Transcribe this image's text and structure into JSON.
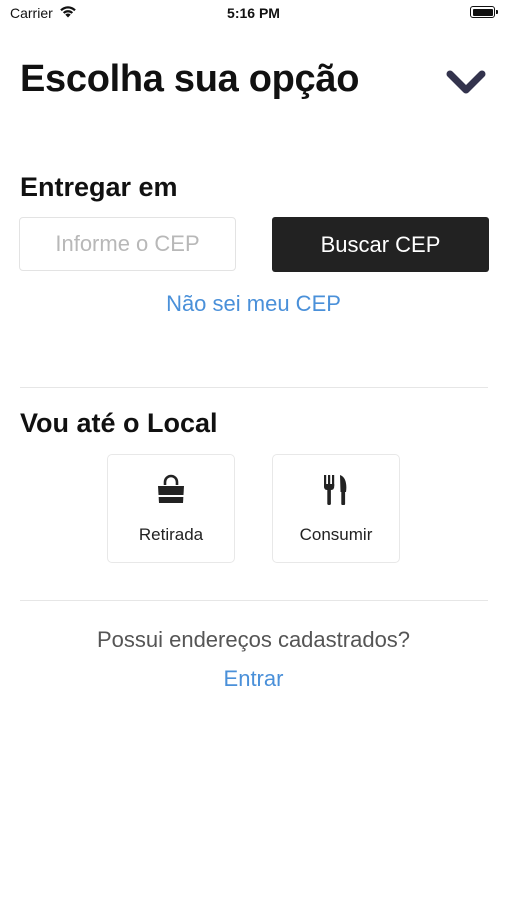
{
  "status_bar": {
    "carrier": "Carrier",
    "time": "5:16 PM"
  },
  "header": {
    "title": "Escolha sua opção",
    "collapse_icon": "chevron-down-icon"
  },
  "delivery": {
    "title": "Entregar em",
    "cep_placeholder": "Informe o CEP",
    "cep_value": "",
    "search_label": "Buscar CEP",
    "no_cep_link": "Não sei meu CEP"
  },
  "local": {
    "title": "Vou até o Local",
    "options": [
      {
        "label": "Retirada",
        "icon": "shopping-bag-icon"
      },
      {
        "label": "Consumir",
        "icon": "fork-knife-icon"
      }
    ]
  },
  "account": {
    "question": "Possui endereços cadastrados?",
    "login_link": "Entrar"
  },
  "colors": {
    "link": "#4a90d9",
    "primary_button": "#222222",
    "chevron": "#33334d"
  }
}
